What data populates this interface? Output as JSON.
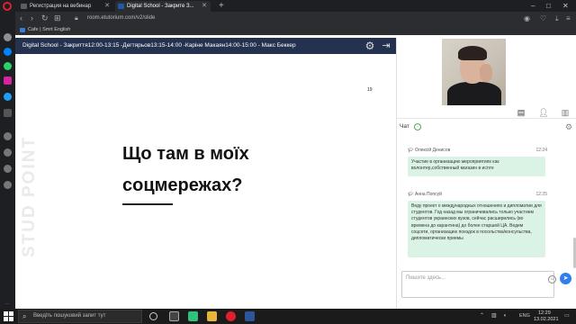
{
  "browser": {
    "tabs": [
      {
        "title": "Регистрация на вебинар",
        "active": false
      },
      {
        "title": "Digital School - Закрите З...",
        "active": true
      }
    ],
    "new_tab_label": "+",
    "url": "room.etutorium.com/v2/slide",
    "bookmark": "Cafe | Smrt English",
    "window_controls": {
      "minimize": "–",
      "maximize": "□",
      "close": "✕"
    }
  },
  "room": {
    "title": "Digital School - Закриття12:00-13:15 -Дегтярьов13:15-14:00 -Каріне Макаян14:00-15:00 - Макс Беккер"
  },
  "slide": {
    "number": "19",
    "line1": "Що там в моїх",
    "line2": "соцмережах?",
    "watermark": "STUD POINT"
  },
  "chat": {
    "title": "Чат",
    "messages": [
      {
        "author": "Олексій Денисов",
        "time": "12:24",
        "text": "Участие в организацию мероприятиях как волонтер,собственный магазин в исnте"
      },
      {
        "author": "Анна Попсуй",
        "time": "12:25",
        "text": "Веду проект о международных отношениях и дипломатии для студентов. Год назад мы ограничивались только участием студентов украинских вузов, сейчас расширились (во времена до карантина) до более старшей ЦА. Ведем соцсети, организацию поездок в посольства/консульства, дипломатически приемы"
      }
    ],
    "input_placeholder": "Пишите здесь..."
  },
  "taskbar": {
    "search_placeholder": "Введіть пошуковий запит тут",
    "language": "ENG",
    "time": "12:29",
    "date": "13.02.2021"
  },
  "colors": {
    "header_bg": "#24324f",
    "bubble_bg": "#dbf3e4",
    "send_button": "#2f7ff0"
  }
}
